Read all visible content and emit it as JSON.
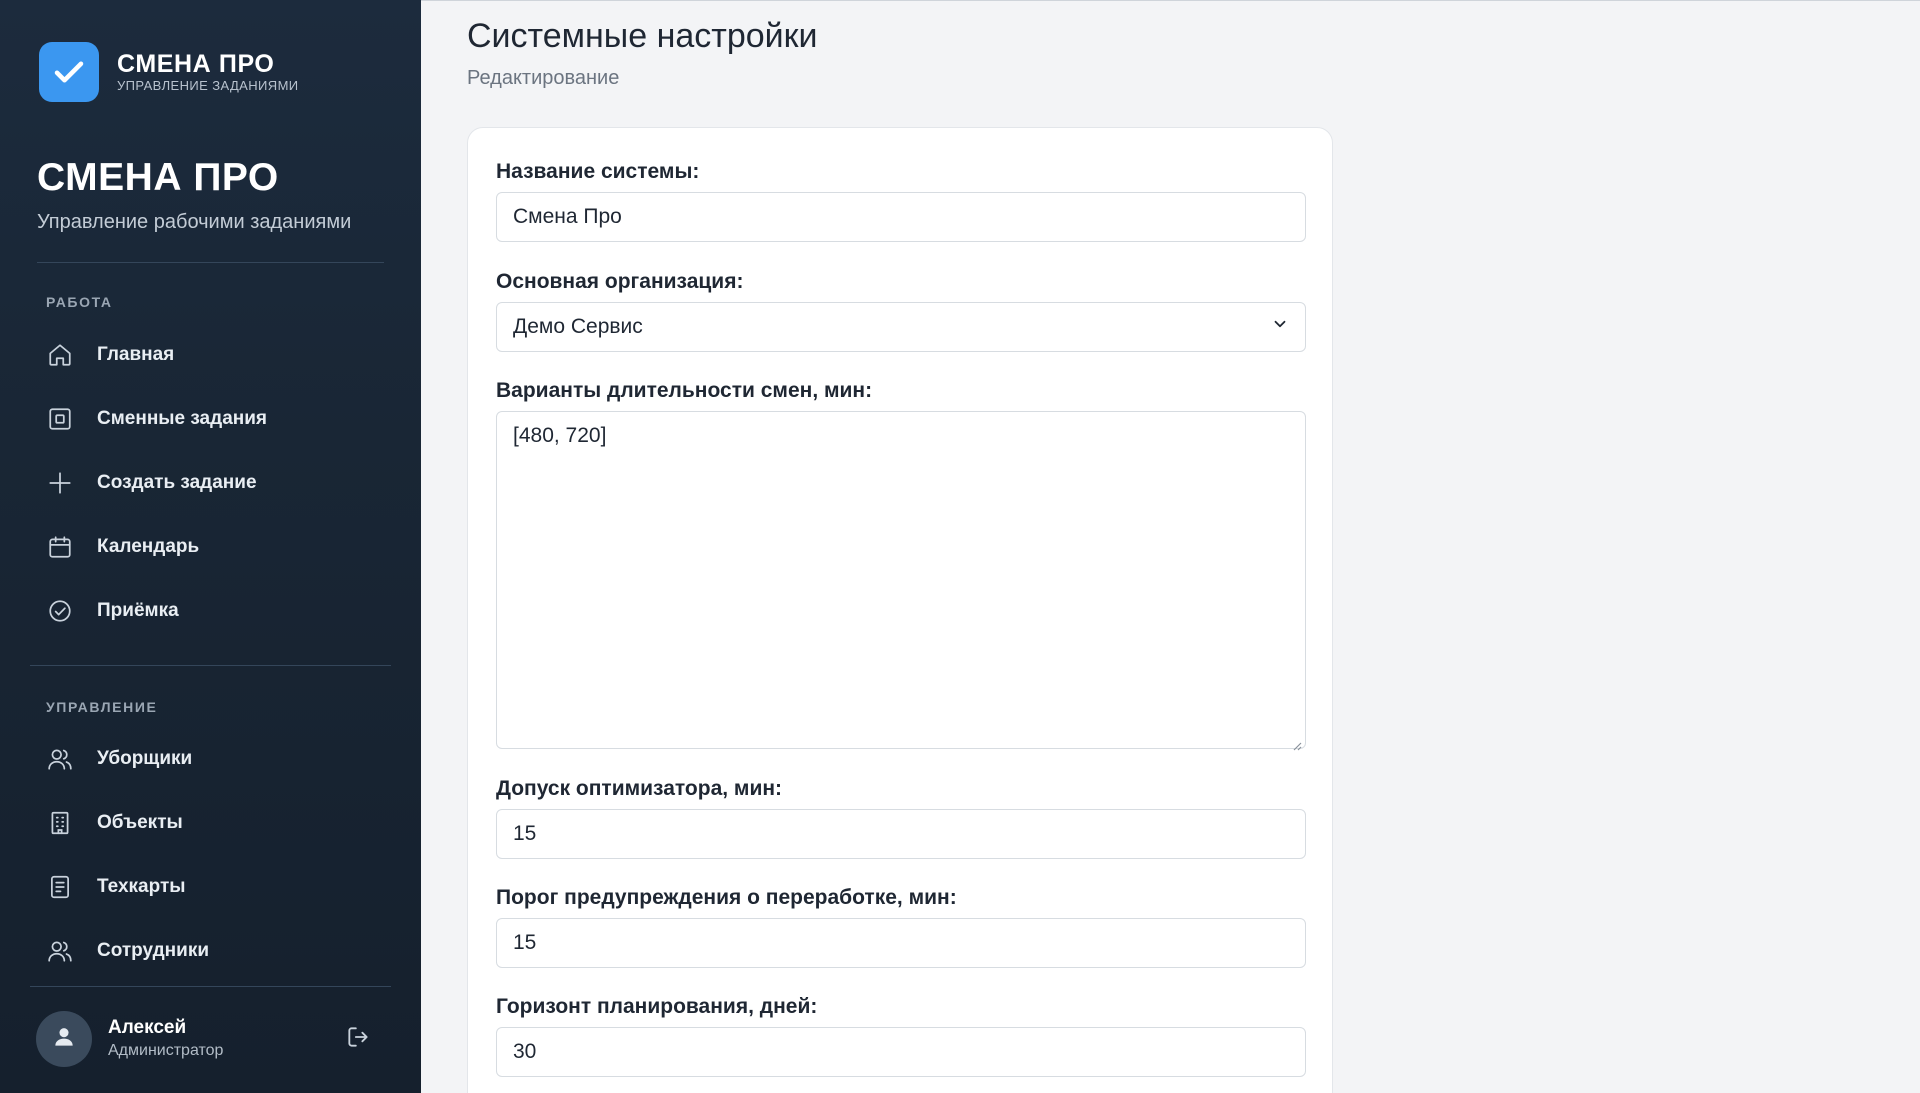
{
  "sidebar": {
    "logo": {
      "name": "СМЕНА ПРО",
      "tagline": "УПРАВЛЕНИЕ ЗАДАНИЯМИ",
      "icon": "check-icon",
      "color": "#3b97f0"
    },
    "brand": {
      "title": "СМЕНА ПРО",
      "subtitle": "Управление рабочими заданиями"
    },
    "sections": [
      {
        "label": "РАБОТА",
        "items": [
          {
            "label": "Главная",
            "icon": "home-icon"
          },
          {
            "label": "Сменные задания",
            "icon": "square-icon"
          },
          {
            "label": "Создать задание",
            "icon": "plus-icon"
          },
          {
            "label": "Календарь",
            "icon": "calendar-icon"
          },
          {
            "label": "Приёмка",
            "icon": "check-circle-icon"
          }
        ]
      },
      {
        "label": "УПРАВЛЕНИЕ",
        "items": [
          {
            "label": "Уборщики",
            "icon": "users-icon"
          },
          {
            "label": "Объекты",
            "icon": "building-icon"
          },
          {
            "label": "Техкарты",
            "icon": "document-icon"
          },
          {
            "label": "Сотрудники",
            "icon": "users-icon"
          }
        ]
      }
    ],
    "user": {
      "name": "Алексей",
      "role": "Администратор",
      "icon": "user-icon"
    },
    "logout_icon": "logout-icon"
  },
  "main": {
    "title": "Системные настройки",
    "subtitle": "Редактирование",
    "form": {
      "system_name": {
        "label": "Название системы:",
        "value": "Смена Про"
      },
      "organization": {
        "label": "Основная организация:",
        "value": "Демо Сервис"
      },
      "shift_durations": {
        "label": "Варианты длительности смен, мин:",
        "value": "[480, 720]"
      },
      "optimizer_tolerance": {
        "label": "Допуск оптимизатора, мин:",
        "value": "15"
      },
      "overtime_threshold": {
        "label": "Порог предупреждения о переработке, мин:",
        "value": "15"
      },
      "planning_horizon": {
        "label": "Горизонт планирования, дней:",
        "value": "30"
      }
    }
  }
}
